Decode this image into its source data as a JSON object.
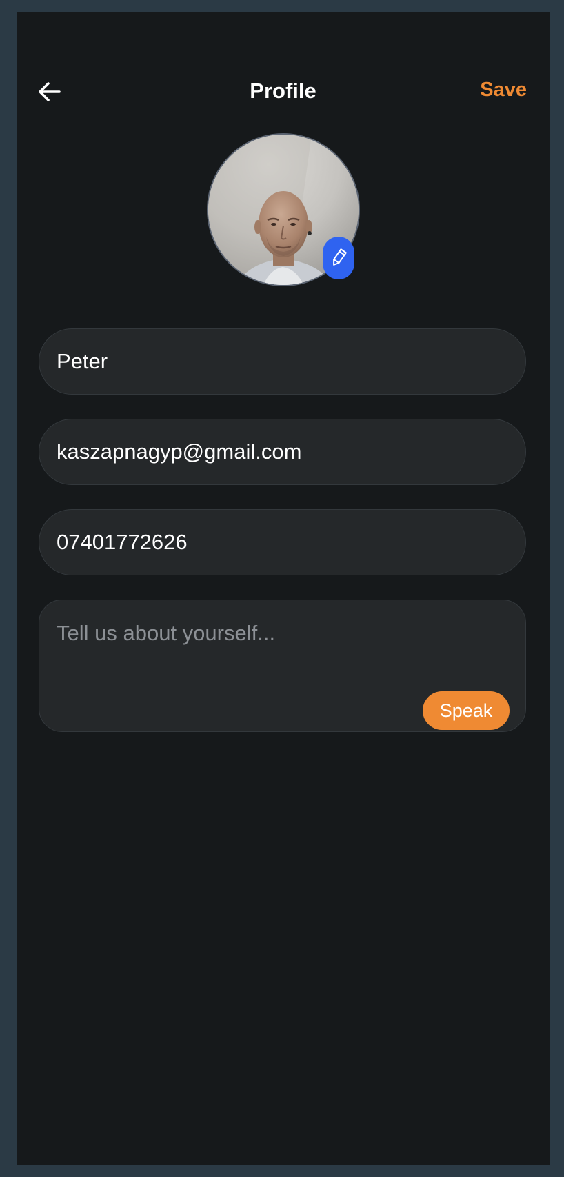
{
  "header": {
    "back_icon": "arrow-left-icon",
    "title": "Profile",
    "save_label": "Save"
  },
  "avatar": {
    "edit_icon": "pencil-icon"
  },
  "form": {
    "name_value": "Peter",
    "email_value": "kaszapnagyp@gmail.com",
    "phone_value": "07401772626",
    "bio_value": "",
    "bio_placeholder": "Tell us about yourself...",
    "speak_label": "Speak"
  },
  "colors": {
    "page_border": "#2b3a45",
    "background": "#16191b",
    "field_background": "#25282a",
    "accent": "#ef8a33",
    "edit_badge": "#2f63f0",
    "text": "#ffffff",
    "placeholder": "#8c9095"
  }
}
